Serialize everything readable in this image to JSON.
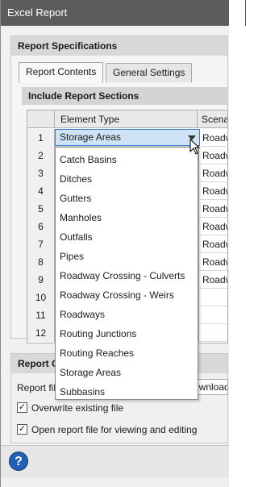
{
  "window": {
    "title": "Excel Report"
  },
  "report_specifications": {
    "header": "Report Specifications",
    "tabs": [
      {
        "label": "Report Contents",
        "active": true
      },
      {
        "label": "General Settings",
        "active": false
      }
    ],
    "include_header": "Include Report Sections",
    "grid": {
      "columns": [
        "Element Type",
        "Scenar"
      ],
      "rows": [
        {
          "num": "1",
          "scenario": "Roadw"
        },
        {
          "num": "2",
          "scenario": "Roadw"
        },
        {
          "num": "3",
          "scenario": "Roadwa"
        },
        {
          "num": "4",
          "scenario": "Roadw"
        },
        {
          "num": "5",
          "scenario": "Roadw"
        },
        {
          "num": "6",
          "scenario": "Roadw"
        },
        {
          "num": "7",
          "scenario": "Roadwa"
        },
        {
          "num": "8",
          "scenario": "Roadw"
        },
        {
          "num": "9",
          "scenario": "Roadw"
        },
        {
          "num": "10",
          "scenario": ""
        },
        {
          "num": "11",
          "scenario": ""
        },
        {
          "num": "12",
          "scenario": ""
        }
      ]
    },
    "combo_selected": "Storage Areas",
    "dropdown_options": [
      "Catch Basins",
      "Ditches",
      "Gutters",
      "Manholes",
      "Outfalls",
      "Pipes",
      "Roadway Crossing - Culverts",
      "Roadway Crossing - Weirs",
      "Roadways",
      "Routing Junctions",
      "Routing Reaches",
      "Storage Areas",
      "Subbasins"
    ]
  },
  "report_output": {
    "header": "Report Ou",
    "file_label": "Report file",
    "file_value": "ownloads",
    "overwrite_label": "Overwrite existing file",
    "overwrite_checked": true,
    "open_label": "Open report file for viewing and editing",
    "open_checked": true
  },
  "footer": {
    "help_icon": "help-icon",
    "help_glyph": "?"
  },
  "colors": {
    "accent": "#3c7fd0",
    "title_bar": "#5c5c5c"
  }
}
